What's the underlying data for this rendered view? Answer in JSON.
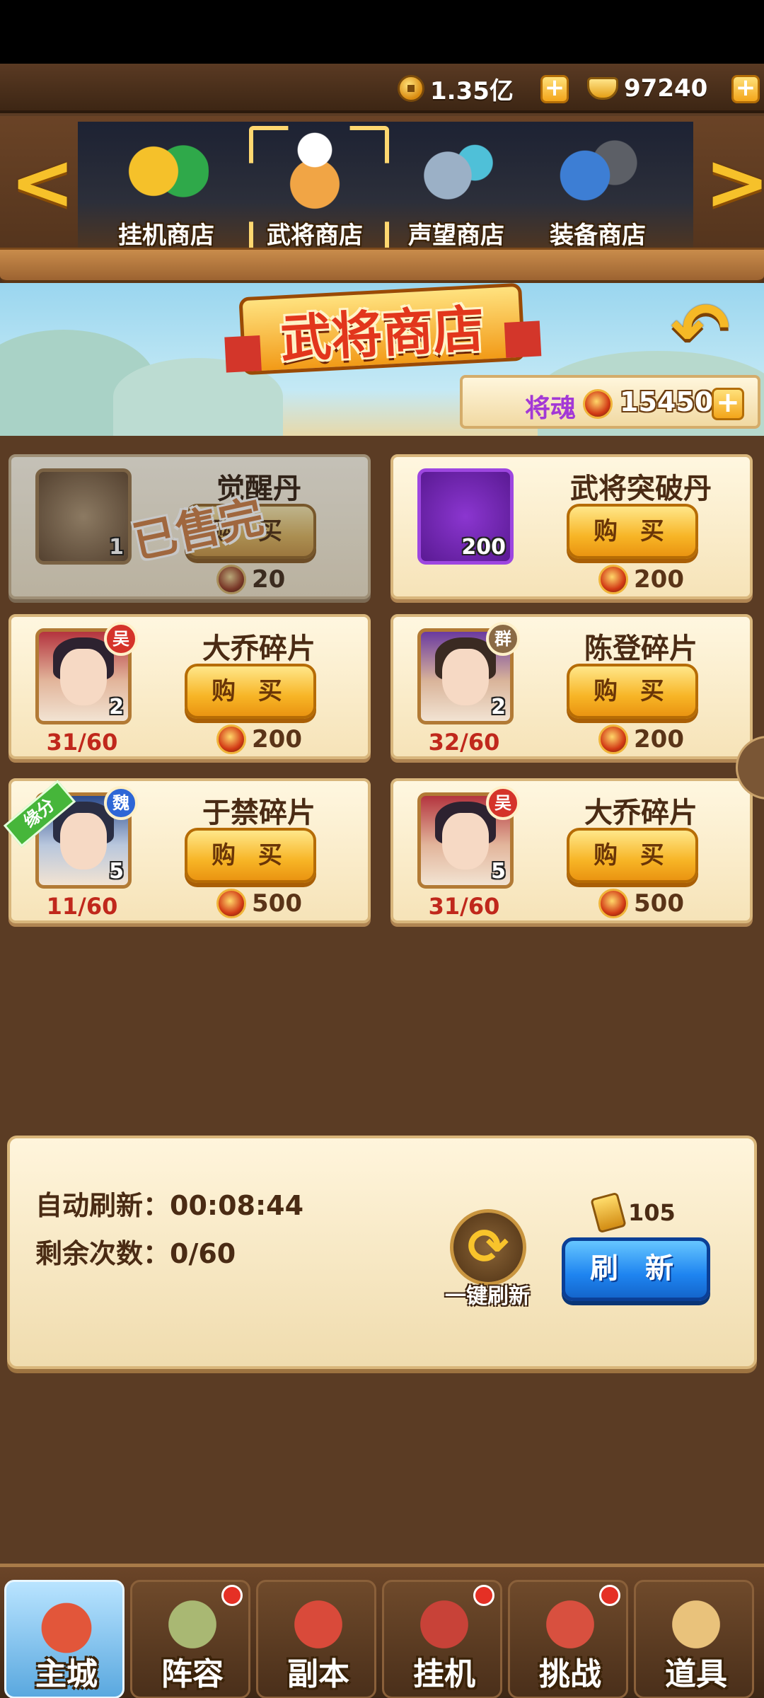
{
  "currency": {
    "copper": "1.35亿",
    "ingot": "97240"
  },
  "shop_tabs": [
    {
      "label": "挂机商店",
      "icon": "jade-coin-icon",
      "color": "#3aa94a"
    },
    {
      "label": "武将商店",
      "icon": "chef-general-icon",
      "color": "#f1a545",
      "selected": true
    },
    {
      "label": "声望商店",
      "icon": "crossed-blades-icon",
      "color": "#9bb0c6"
    },
    {
      "label": "装备商店",
      "icon": "armor-icon",
      "color": "#3d7ed4"
    }
  ],
  "header": {
    "title": "武将商店",
    "soul_label": "将魂",
    "soul_value": "15450"
  },
  "items": [
    {
      "name": "觉醒丹",
      "qty": "1",
      "price": "20",
      "sold_out": true,
      "stamp": "已售完",
      "buy_label": "购 买"
    },
    {
      "name": "武将突破丹",
      "qty": "200",
      "price": "200",
      "buy_label": "购 买"
    },
    {
      "name": "大乔碎片",
      "qty": "2",
      "price": "200",
      "progress": "31/60",
      "faction": "吴",
      "buy_label": "购 买"
    },
    {
      "name": "陈登碎片",
      "qty": "2",
      "price": "200",
      "progress": "32/60",
      "faction": "群",
      "buy_label": "购 买"
    },
    {
      "name": "于禁碎片",
      "qty": "5",
      "price": "500",
      "progress": "11/60",
      "faction": "魏",
      "tag": "缘分",
      "buy_label": "购 买"
    },
    {
      "name": "大乔碎片",
      "qty": "5",
      "price": "500",
      "progress": "31/60",
      "faction": "吴",
      "buy_label": "购 买"
    }
  ],
  "refresh": {
    "auto_label": "自动刷新：",
    "auto_time": "00:08:44",
    "remaining_label": "剩余次数：",
    "remaining_value": "0/60",
    "one_key_label": "一键刷新",
    "cost": "105",
    "button_label": "刷 新"
  },
  "nav": [
    {
      "label": "主城",
      "active": true,
      "dot": false,
      "color": "#e2563a"
    },
    {
      "label": "阵容",
      "active": false,
      "dot": true,
      "color": "#a9b873"
    },
    {
      "label": "副本",
      "active": false,
      "dot": false,
      "color": "#d94a3a"
    },
    {
      "label": "挂机",
      "active": false,
      "dot": true,
      "color": "#c84238"
    },
    {
      "label": "挑战",
      "active": false,
      "dot": true,
      "color": "#d8503f"
    },
    {
      "label": "道具",
      "active": false,
      "dot": false,
      "color": "#e9c27b"
    }
  ]
}
